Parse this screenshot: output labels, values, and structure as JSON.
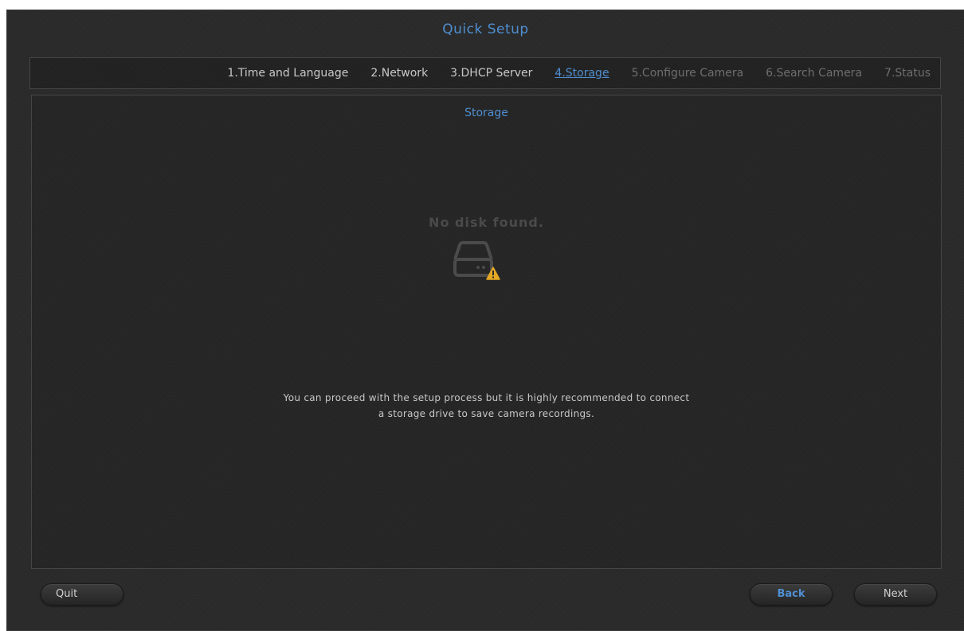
{
  "window": {
    "title": "Quick Setup"
  },
  "steps": [
    {
      "label": "1.Time and Language",
      "state": "done"
    },
    {
      "label": "2.Network",
      "state": "done"
    },
    {
      "label": "3.DHCP Server",
      "state": "done"
    },
    {
      "label": "4.Storage",
      "state": "active"
    },
    {
      "label": "5.Configure Camera",
      "state": "future"
    },
    {
      "label": "6.Search Camera",
      "state": "future"
    },
    {
      "label": "7.Status",
      "state": "future"
    }
  ],
  "panel": {
    "title": "Storage",
    "status": "No disk found.",
    "icon": "hard-drive-warning-icon",
    "message_line1": "You can proceed with the setup process but it is highly recommended to connect",
    "message_line2": "a storage drive to save camera recordings."
  },
  "buttons": {
    "quit": "Quit",
    "back": "Back",
    "next": "Next"
  },
  "colors": {
    "accent": "#4f8fd1",
    "warning": "#e5a823",
    "background": "#2b2b2b"
  }
}
